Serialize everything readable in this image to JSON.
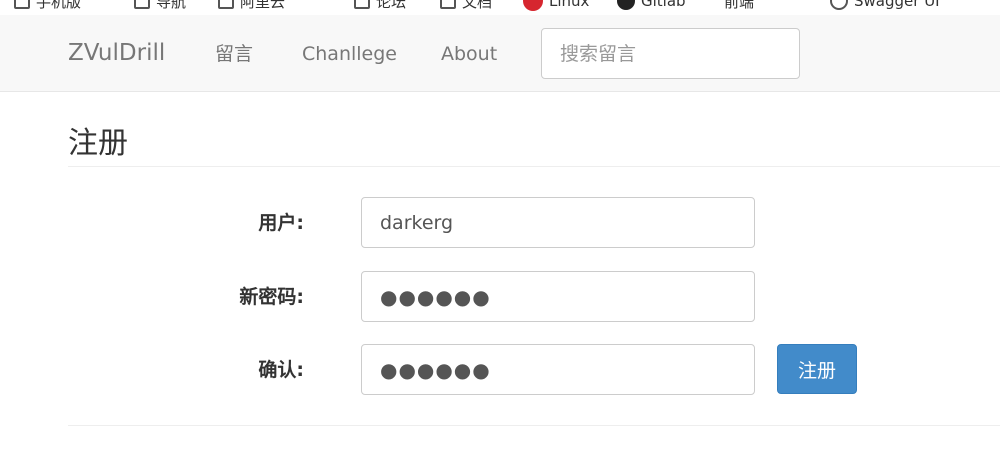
{
  "bookmarks": {
    "items": [
      {
        "label": "手机版",
        "icon": "folder-icon"
      },
      {
        "label": "导航",
        "icon": "folder-icon"
      },
      {
        "label": "阿里云",
        "icon": "folder-icon"
      },
      {
        "label": "论坛",
        "icon": "folder-icon"
      },
      {
        "label": "文档",
        "icon": "folder-icon"
      },
      {
        "label": "Linux",
        "icon": "red-circle-icon"
      },
      {
        "label": "Gitlab",
        "icon": "github-icon"
      },
      {
        "label": "前端",
        "icon": "folder-icon"
      },
      {
        "label": "Swagger UI",
        "icon": "globe-icon"
      }
    ]
  },
  "navbar": {
    "brand": "ZVulDrill",
    "links": [
      "留言",
      "Chanllege",
      "About"
    ],
    "search_placeholder": "搜索留言"
  },
  "page": {
    "title": "注册"
  },
  "form": {
    "username_label": "用户:",
    "username_value": "darkerg",
    "password_label": "新密码:",
    "password_value": "●●●●●●",
    "confirm_label": "确认:",
    "confirm_value": "●●●●●●",
    "submit_label": "注册"
  },
  "colors": {
    "navbar_bg": "#f8f8f8",
    "primary_button": "#428bca"
  }
}
